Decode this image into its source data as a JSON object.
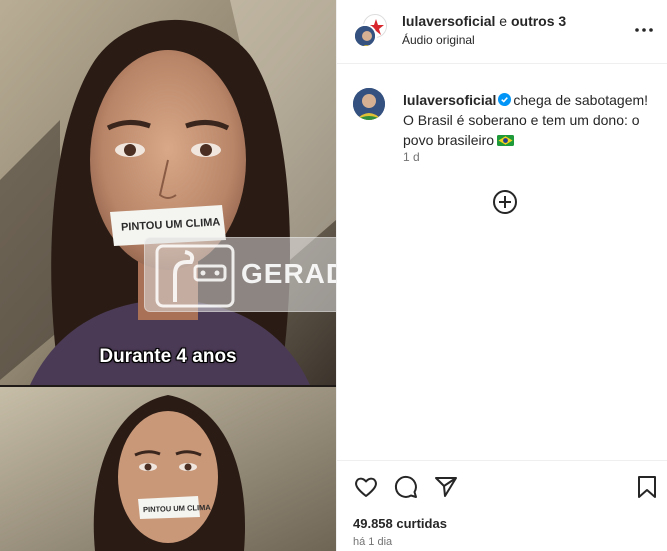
{
  "media": {
    "caption": "Durante 4 anos",
    "tape_text_top": "PINTOU UM CLIMA",
    "tape_text_bottom": "PINTOU UM CLIMA",
    "ai_label": "GERADO POR IA"
  },
  "header": {
    "primary_user": "lulaversoficial",
    "connector": " e ",
    "others": "outros 3",
    "audio": "Áudio original",
    "more_icon": "more-horizontal-icon"
  },
  "post": {
    "username": "lulaversoficial",
    "verified_icon": "verified-badge-icon",
    "caption": "chega de sabotagem! O Brasil é soberano e tem um dono: o povo brasileiro",
    "flag_icon": "brazil-flag-emoji",
    "time": "1 d"
  },
  "load_more_icon": "plus-circle-icon",
  "actions": {
    "like_icon": "heart-icon",
    "comment_icon": "comment-icon",
    "share_icon": "send-icon",
    "save_icon": "bookmark-icon",
    "likes": "49.858 curtidas",
    "posted_ago": "há 1 dia"
  },
  "colors": {
    "verified": "#0095f6",
    "text": "#262626",
    "muted": "#737373",
    "border": "#efefef"
  }
}
